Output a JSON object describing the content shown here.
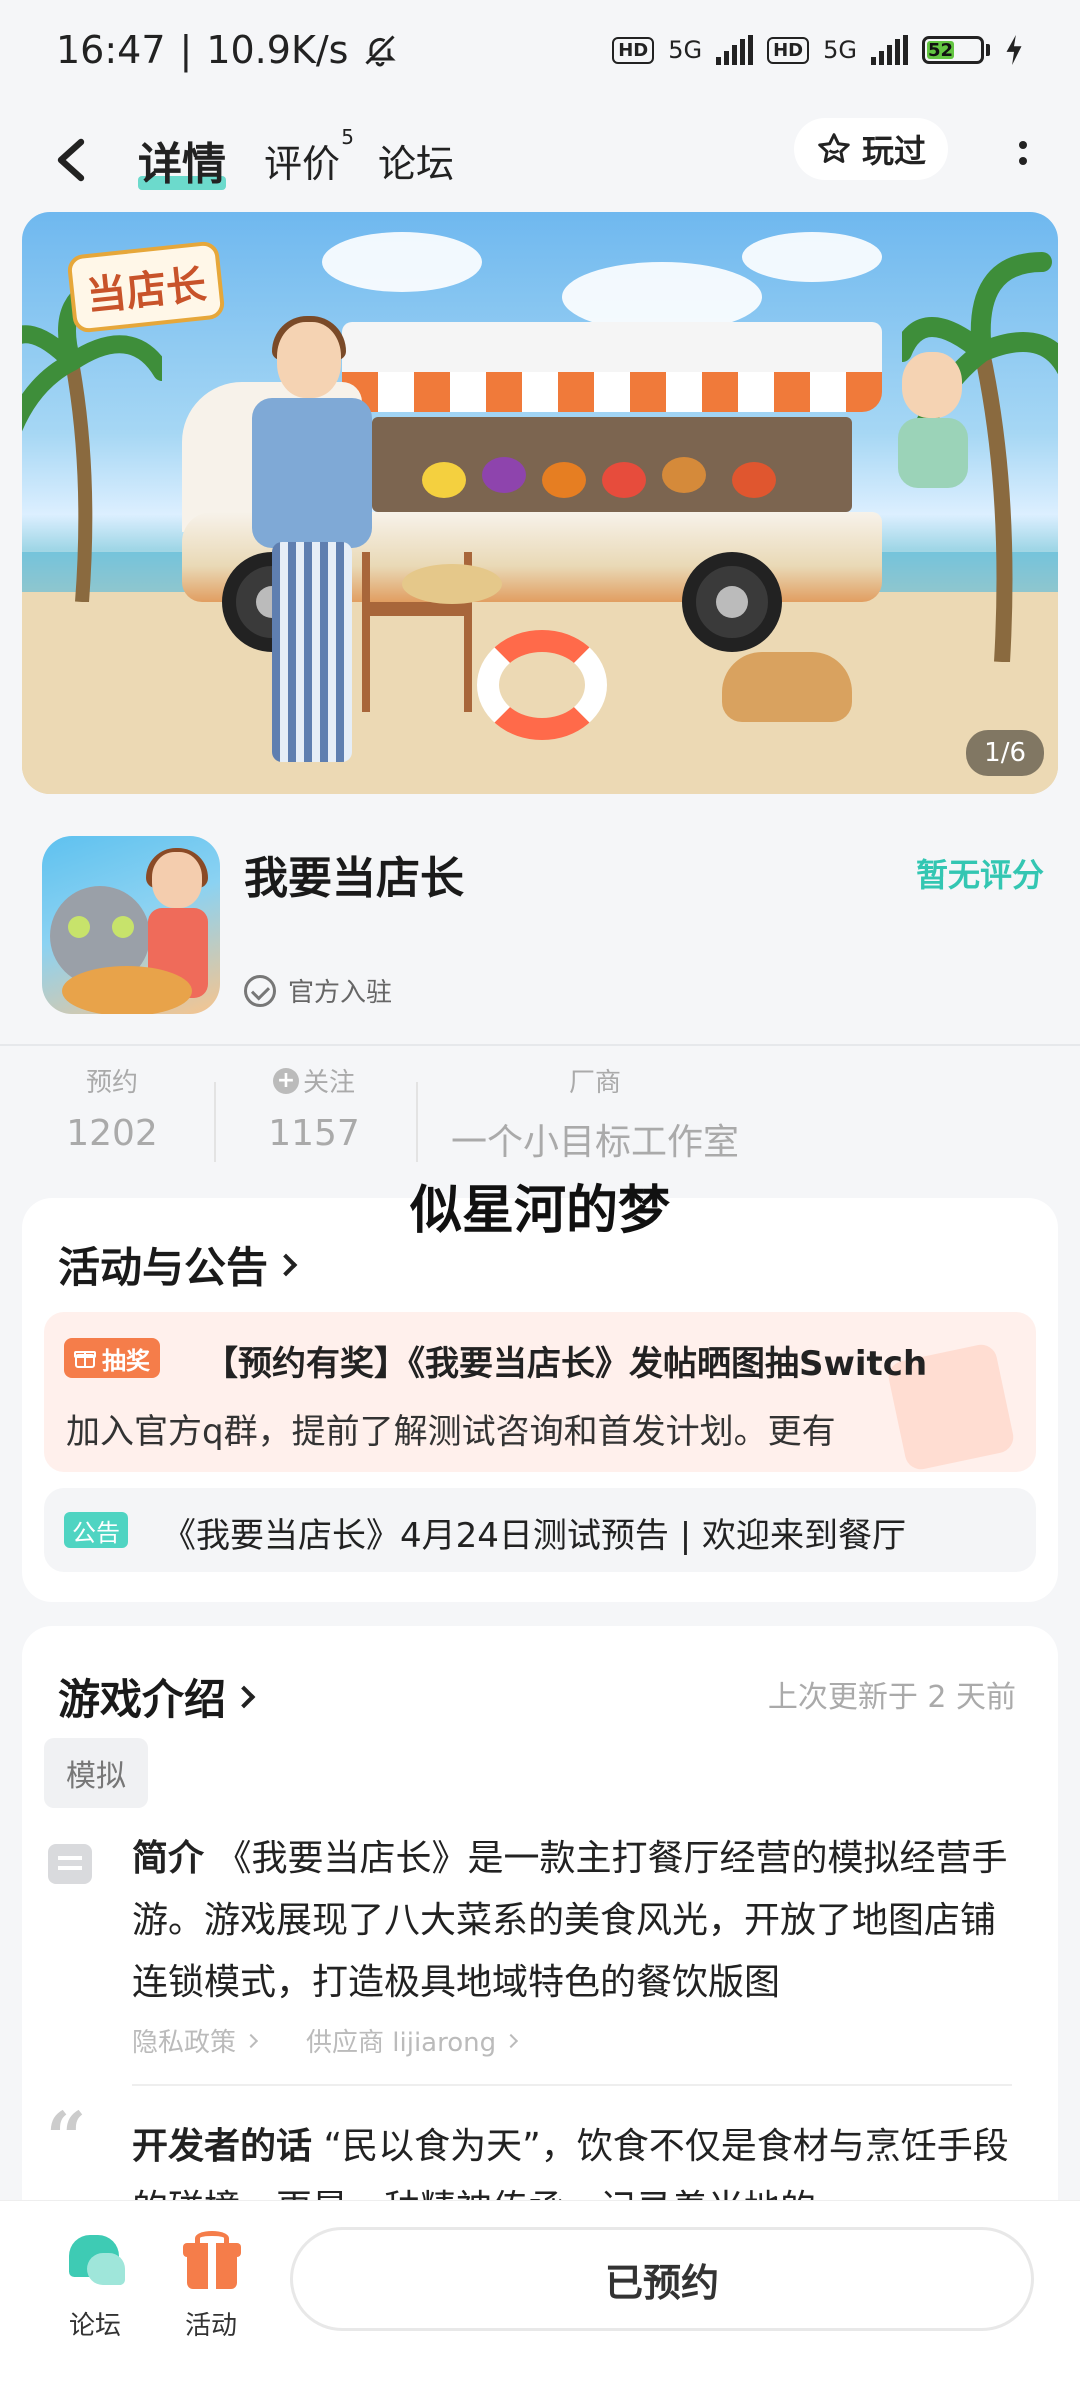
{
  "status_bar": {
    "time": "16:47",
    "speed": "10.9K/s",
    "network1": "5G",
    "network2": "5G",
    "hd_label": "HD",
    "battery": "52"
  },
  "nav": {
    "tabs": [
      {
        "label": "详情",
        "active": true
      },
      {
        "label": "评价",
        "badge": "5"
      },
      {
        "label": "论坛"
      }
    ],
    "played_label": "玩过"
  },
  "banner": {
    "logo_text": "当店长",
    "counter": "1/6"
  },
  "app": {
    "name": "我要当店长",
    "rating": "暂无评分",
    "official_label": "官方入驻"
  },
  "stats": {
    "reserve": {
      "label": "预约",
      "value": "1202"
    },
    "follow": {
      "label": "关注",
      "value": "1157"
    },
    "vendor": {
      "label": "厂商",
      "value": "一个小目标工作室"
    }
  },
  "overlay_username": "似星河的梦",
  "activities": {
    "title": "活动与公告",
    "promo": {
      "badge": "抽奖",
      "title": "【预约有奖】《我要当店长》发帖晒图抽Switch",
      "subtitle": "加入官方q群，提前了解测试咨询和首发计划。更有"
    },
    "notice": {
      "badge": "公告",
      "text": "《我要当店长》4月24日测试预告 | 欢迎来到餐厅"
    }
  },
  "intro": {
    "title": "游戏介绍",
    "updated": "上次更新于 2 天前",
    "tag": "模拟",
    "summary_lead": "简介",
    "summary": "《我要当店长》是一款主打餐厅经营的模拟经营手游。游戏展现了八大菜系的美食风光，开放了地图店铺连锁模式，打造极具地域特色的餐饮版图",
    "privacy_link": "隐私政策",
    "supplier_link": "供应商 lijiarong",
    "dev_lead": "开发者的话",
    "dev_text": "“民以食为天”，饮食不仅是食材与烹饪手段的碰撞，更是一种精神传承，记录着当地的"
  },
  "bottom": {
    "forum_label": "论坛",
    "activity_label": "活动",
    "reserved_label": "已预约"
  },
  "colors": {
    "accent": "#3ed0bd",
    "rating": "#33c6b2",
    "promo_orange": "#f57d4a"
  }
}
